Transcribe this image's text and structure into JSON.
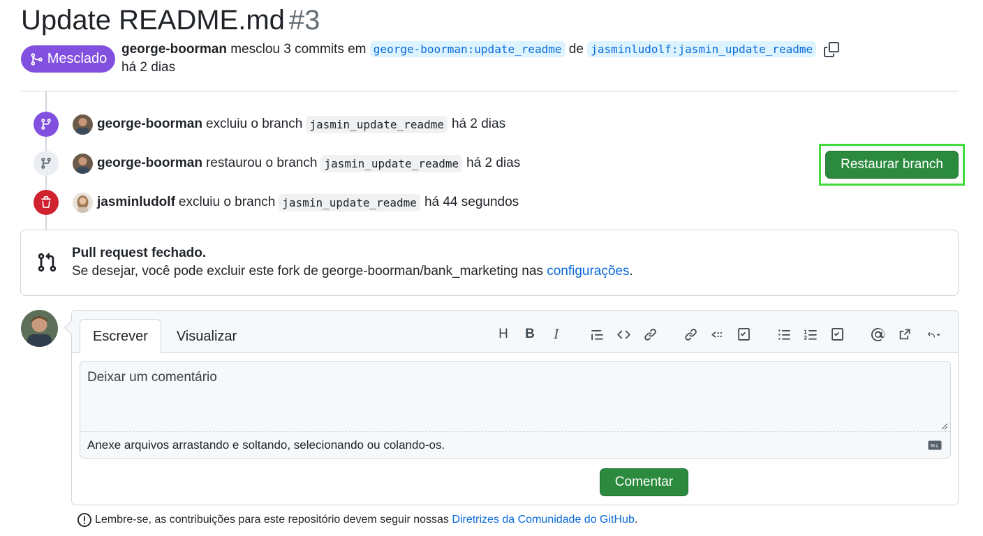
{
  "pr": {
    "title": "Update README.md",
    "number": "#3",
    "status": "Mesclado",
    "author": "george-boorman",
    "merged_text": "mesclou 3 commits em",
    "base_branch": "george-boorman:update_readme",
    "de": "de",
    "head_branch": "jasminludolf:jasmin_update_readme",
    "time": "há 2 dias"
  },
  "timeline": [
    {
      "user": "george-boorman",
      "action": "excluiu o branch",
      "branch": "jasmin_update_readme",
      "time": "há 2 dias",
      "icon": "git-branch-icon"
    },
    {
      "user": "george-boorman",
      "action": "restaurou o branch",
      "branch": "jasmin_update_readme",
      "time": "há 2 dias",
      "icon": "git-branch-icon"
    },
    {
      "user": "jasminludolf",
      "action": "excluiu o branch",
      "branch": "jasmin_update_readme",
      "time": "há 44 segundos",
      "icon": "trash-icon"
    }
  ],
  "restore_button": "Restaurar branch",
  "closed": {
    "title": "Pull request fechado.",
    "desc": "Se desejar, você pode excluir este fork de george-boorman/bank_marketing nas",
    "link": "configurações",
    "end": "."
  },
  "comment": {
    "tab_write": "Escrever",
    "tab_preview": "Visualizar",
    "placeholder": "Deixar um comentário",
    "attach": "Anexe arquivos arrastando e soltando, selecionando ou colando-os.",
    "submit": "Comentar"
  },
  "toolbar": {
    "heading": "H",
    "bold": "B",
    "italic": "I"
  },
  "footer": {
    "text": "Lembre-se, as contribuições para este repositório devem seguir nossas",
    "link": "Diretrizes da Comunidade do GitHub",
    "end": "."
  },
  "colors": {
    "merged": "#8250df",
    "green": "#2b8a3e",
    "danger": "#cf222e",
    "link": "#0969da",
    "highlight": "#3fdc3c"
  }
}
